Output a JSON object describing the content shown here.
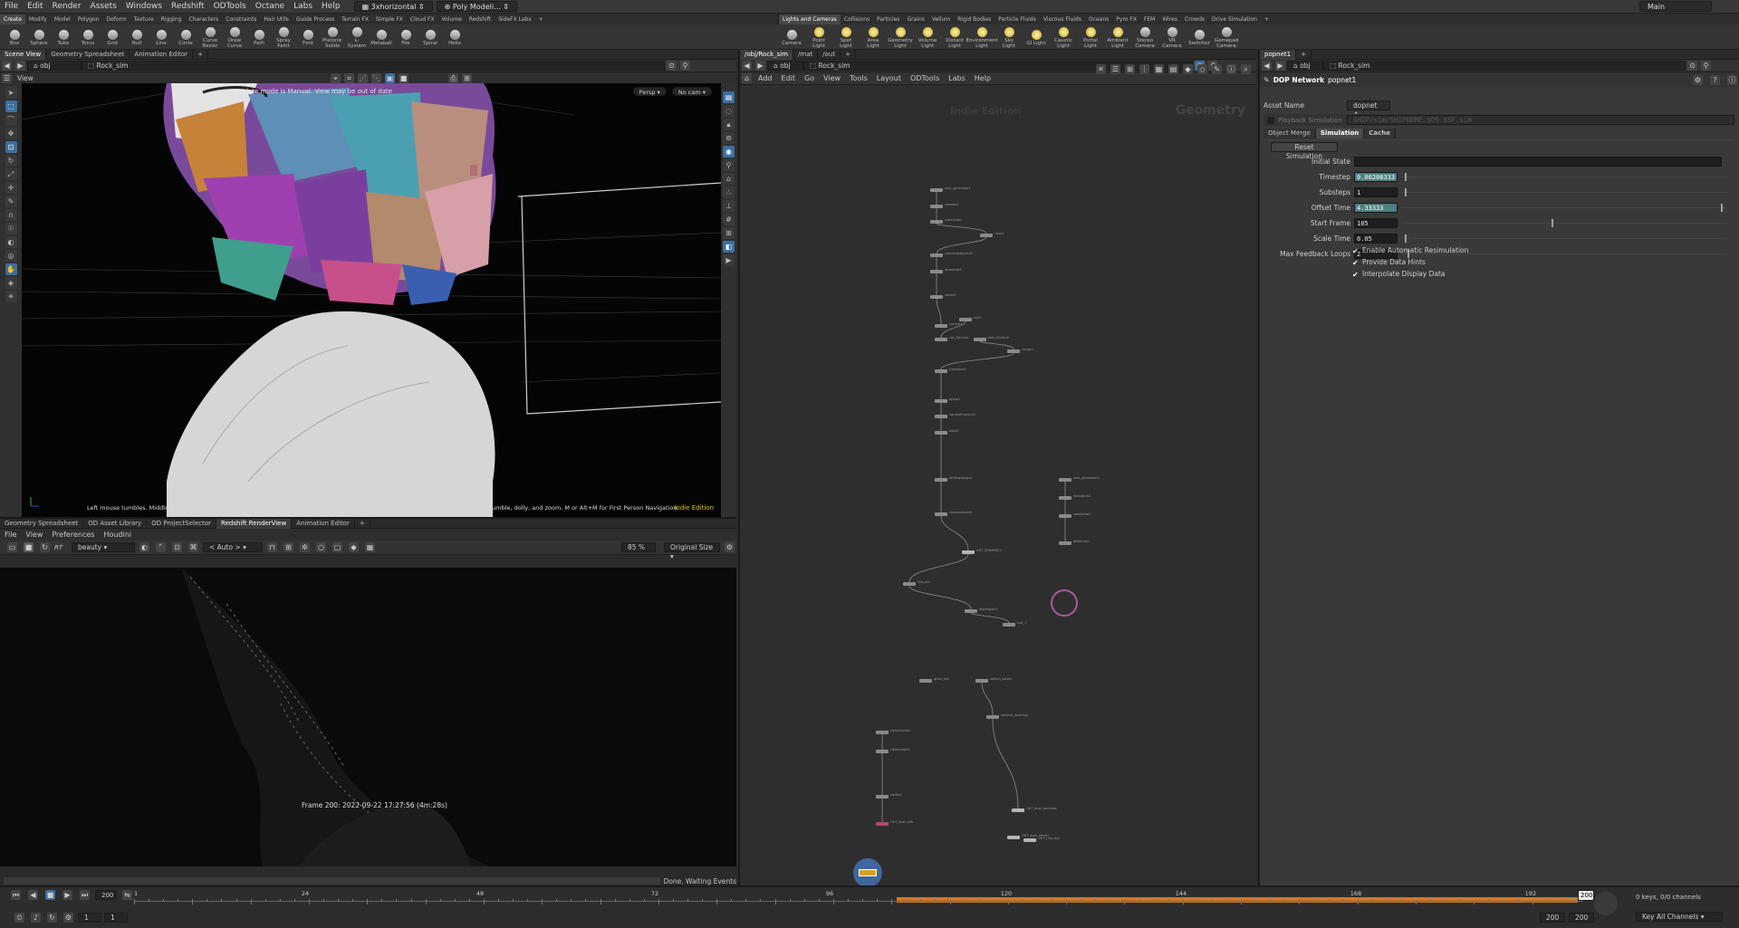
{
  "menubar": {
    "items": [
      "File",
      "Edit",
      "Render",
      "Assets",
      "Windows",
      "Redshift",
      "ODTools",
      "Octane",
      "Labs",
      "Help"
    ],
    "desktop": "3xhorizontal",
    "context": "Poly Modeli...",
    "workspace": "Main"
  },
  "shelf_left": {
    "tabs": [
      "Create",
      "Modify",
      "Model",
      "Polygon",
      "Deform",
      "Texture",
      "Rigging",
      "Characters",
      "Constraints",
      "Hair Utils",
      "Guide Process",
      "Terrain FX",
      "Simple FX",
      "Cloud FX",
      "Volume",
      "Redshift",
      "SideFX Labs"
    ],
    "tools": [
      "Box",
      "Sphere",
      "Tube",
      "Torus",
      "Grid",
      "Null",
      "Line",
      "Circle",
      "Curve Bezier",
      "Draw Curve",
      "Path",
      "Spray Paint",
      "Font",
      "Platonic Solids",
      "L-System",
      "Metaball",
      "File",
      "Spiral",
      "Helix"
    ]
  },
  "shelf_right": {
    "tabs": [
      "Lights and Cameras",
      "Collisions",
      "Particles",
      "Grains",
      "Vellum",
      "Rigid Bodies",
      "Particle Fluids",
      "Viscous Fluids",
      "Oceans",
      "Pyro FX",
      "FEM",
      "Wires",
      "Crowds",
      "Drive Simulation"
    ],
    "tools": [
      "Camera",
      "Point Light",
      "Spot Light",
      "Area Light",
      "Geometry Light",
      "Volume Light",
      "Distant Light",
      "Environment Light",
      "Sky Light",
      "GI Light",
      "Caustic Light",
      "Portal Light",
      "Ambient Light",
      "Stereo Camera",
      "VR Camera",
      "Switcher",
      "Gamepad Camera"
    ]
  },
  "viewport": {
    "tabs": [
      "Scene View",
      "Geometry Spreadsheet",
      "Animation Editor"
    ],
    "path": "obj",
    "node": "Rock_sim",
    "label": "View",
    "persp": "Persp",
    "cam": "No cam",
    "warning": "Update mode is Manual. View may be out of date",
    "hint": "Left mouse tumbles. Middle pans. Right dollies. Ctrl+Alt+Left box-zooms. Ctrl+Right zooms. Spacebar-Ctrl-Left tilts. Hold L for alternate tumble, dolly, and zoom.    M or Alt+M for First Person Navigation.",
    "edition": "Indie Edition"
  },
  "renderview": {
    "tabs": [
      "Geometry Spreadsheet",
      "OD Asset Library",
      "OD ProjectSelector",
      "Redshift RenderView",
      "Animation Editor"
    ],
    "menu": [
      "File",
      "View",
      "Preferences",
      "Houdini"
    ],
    "aov": "beauty",
    "camera": "< Auto >",
    "zoom": "85 %",
    "size": "Original Size",
    "rt": "RT",
    "frame_info": "Frame  200:  2022-09-22  17:27:56  (4m:28s)",
    "status": "Done. Waiting Events"
  },
  "network": {
    "tabs": [
      "/obj/Rock_sim",
      "/mat",
      "/out"
    ],
    "path": "obj",
    "node": "Rock_sim",
    "menu": [
      "Add",
      "Edit",
      "Go",
      "View",
      "Tools",
      "Layout",
      "ODTools",
      "Labs",
      "Help"
    ],
    "watermark": "Indie Edition",
    "context": "Geometry"
  },
  "params": {
    "tab": "popnet1",
    "path": "obj",
    "node": "Rock_sim",
    "type": "DOP Network",
    "name": "popnet1",
    "asset_label": "Asset Name",
    "asset_value": "dopnet",
    "playback_label": "Playback Simulation",
    "playback_path": "$HIP/sim/$HIPNAME.$OS.$SF.sim",
    "tabs": [
      "Object Merge",
      "Simulation",
      "Cache"
    ],
    "reset": "Reset Simulation",
    "fields": [
      {
        "label": "Initial State",
        "value": ""
      },
      {
        "label": "Timestep",
        "value": "0.00208333"
      },
      {
        "label": "Substeps",
        "value": "1"
      },
      {
        "label": "Offset Time",
        "value": "4.33333"
      },
      {
        "label": "Start Frame",
        "value": "105"
      },
      {
        "label": "Scale Time",
        "value": "0.05"
      },
      {
        "label": "Max Feedback Loops",
        "value": "2"
      }
    ],
    "checks": [
      "Enable Automatic Resimulation",
      "Provide Data Hints",
      "Interpolate Display Data"
    ]
  },
  "timeline": {
    "frame": "200",
    "ticks": [
      "1",
      "24",
      "48",
      "72",
      "96",
      "120",
      "144",
      "168",
      "192"
    ],
    "end": "200",
    "start": "1",
    "step": "1",
    "range_end_a": "200",
    "range_end_b": "200",
    "keys": "0 keys, 0/0 channels",
    "key_all": "Key All Channels"
  },
  "nodes": [
    "rock_generator1",
    "remesh1",
    "subdivide1",
    "color1",
    "connectadjacent1",
    "assemble1",
    "solver1",
    "normal1",
    "null1",
    "rbd_fracture",
    "rock_fracture",
    "merge1",
    "transform1",
    "group1",
    "voronoifracture1",
    "blast1",
    "attribwrangle1",
    "rbdconstraint1",
    "OUT_DYNAMICS",
    "rbd_sim",
    "dopimport1",
    "null_1",
    "rock_generator2",
    "transform2",
    "subdivide2",
    "attribvop1",
    "grain_sim",
    "vellum_solver",
    "volume_rasterize",
    "OUT_dust_particles",
    "convertvdb1",
    "vdbsmooth1",
    "cache1",
    "OUT_dust_vdb",
    "OUT_rest_rbd",
    "OUT_dust_render"
  ]
}
